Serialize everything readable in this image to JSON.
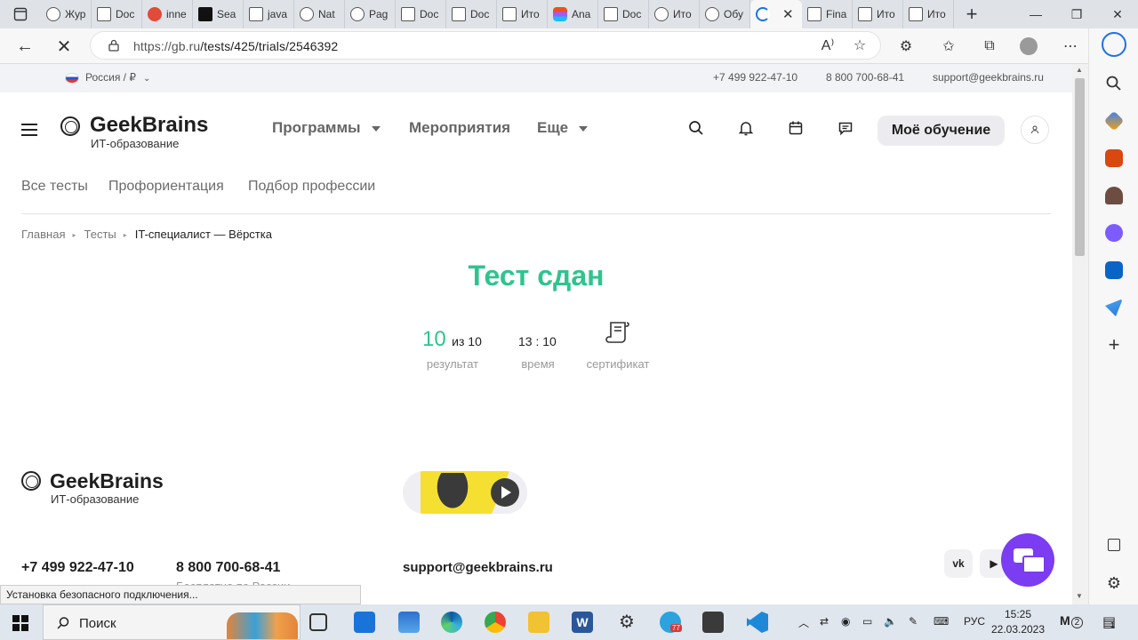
{
  "browser": {
    "tabs": [
      {
        "label": "Жур",
        "icon": "history-icon"
      },
      {
        "label": "Doc",
        "icon": "document-icon"
      },
      {
        "label": "inne",
        "icon": "yandex-icon"
      },
      {
        "label": "Sea",
        "icon": "medium-icon"
      },
      {
        "label": "java",
        "icon": "java-icon"
      },
      {
        "label": "Nat",
        "icon": "github-icon"
      },
      {
        "label": "Pag",
        "icon": "github-icon"
      },
      {
        "label": "Doc",
        "icon": "document-icon"
      },
      {
        "label": "Doc",
        "icon": "document-icon"
      },
      {
        "label": "Ито",
        "icon": "document-icon"
      },
      {
        "label": "Ana",
        "icon": "figma-icon"
      },
      {
        "label": "Doc",
        "icon": "document-icon"
      },
      {
        "label": "Ито",
        "icon": "openai-icon"
      },
      {
        "label": "Обу",
        "icon": "openai-icon"
      },
      {
        "label": "",
        "icon": "loading-icon",
        "active": true
      },
      {
        "label": "Fina",
        "icon": "document-icon"
      },
      {
        "label": "Ито",
        "icon": "document-icon"
      },
      {
        "label": "Ито",
        "icon": "document-icon"
      }
    ],
    "url_host": "https://gb.ru",
    "url_path": "/tests/425/trials/2546392",
    "status_text": "Установка безопасного подключения..."
  },
  "site": {
    "region": "Россия / ₽",
    "phones": [
      "+7 499 922-47-10",
      "8 800 700-68-41"
    ],
    "email": "support@geekbrains.ru",
    "logo_title": "GeekBrains",
    "logo_subtitle": "ИТ-образование",
    "menu": [
      {
        "label": "Программы",
        "dropdown": true
      },
      {
        "label": "Мероприятия",
        "dropdown": false
      },
      {
        "label": "Еще",
        "dropdown": true
      }
    ],
    "cta_label": "Моё обучение",
    "subnav": [
      "Все тесты",
      "Профориентация",
      "Подбор профессии"
    ],
    "breadcrumbs": [
      "Главная",
      "Тесты",
      "IT-специалист — Вёрстка"
    ]
  },
  "result": {
    "title": "Тест сдан",
    "score": "10",
    "score_of": "из 10",
    "score_label": "результат",
    "time": "13 : 10",
    "time_label": "время",
    "certificate_label": "сертификат",
    "accent_color": "#2fc48d"
  },
  "footer": {
    "logo_title": "GeekBrains",
    "logo_subtitle": "ИТ-образование",
    "phone1": "+7 499 922-47-10",
    "phone2": "8 800 700-68-41",
    "phone2_note": "Бесплатно по России",
    "email": "support@geekbrains.ru",
    "social": [
      "vk-icon",
      "youtube-icon"
    ],
    "chat_color": "#7b3cf2"
  },
  "taskbar": {
    "search_placeholder": "Поиск",
    "language": "РУС",
    "time": "15:25",
    "date": "22.03.2023",
    "telegram_badge": "77",
    "notification_count": "2",
    "corner_badge": "1"
  }
}
